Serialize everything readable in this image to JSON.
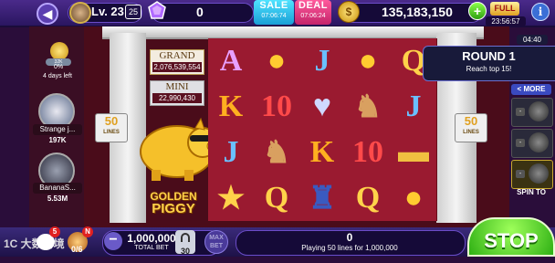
{
  "topbar": {
    "level_label": "Lv. 23",
    "level_badge": "25",
    "gems": "0",
    "sale": {
      "label": "SALE",
      "date": "07:06:74"
    },
    "deal": {
      "label": "DEAL",
      "date": "07:06:24"
    },
    "coins": "135,183,150",
    "plus": "+",
    "full_label": "FULL",
    "full_timer": "23:56:57",
    "info": "i",
    "back": "◀"
  },
  "piggy_bank": {
    "percent": "0%",
    "days_left": "4 days left",
    "amount": "32K"
  },
  "players": [
    {
      "name": "Strange j...",
      "coins": "197K"
    },
    {
      "name": "BananaS...",
      "coins": "5.53M"
    }
  ],
  "machine": {
    "lines_number": "50",
    "lines_label": "LINES",
    "grand_label": "GRAND",
    "grand_value": "2,076,539,554",
    "mini_label": "MINI",
    "mini_value": "22,990,430",
    "logo_line1": "GOLDEN",
    "logo_line2": "PIGGY"
  },
  "reels": [
    [
      {
        "s": "A",
        "c": "#e8a0ff"
      },
      {
        "s": "K",
        "c": "#ffb020"
      },
      {
        "s": "J",
        "c": "#6ac0ff"
      },
      {
        "s": "★",
        "c": "#ffd24a"
      }
    ],
    [
      {
        "s": "●",
        "c": "#ffcc30"
      },
      {
        "s": "10",
        "c": "#ff4a4a"
      },
      {
        "s": "♞",
        "c": "#d9a060"
      },
      {
        "s": "Q",
        "c": "#ffd24a"
      }
    ],
    [
      {
        "s": "J",
        "c": "#6ac0ff"
      },
      {
        "s": "♥",
        "c": "#cfd8ff"
      },
      {
        "s": "K",
        "c": "#ffb020"
      },
      {
        "s": "♜",
        "c": "#3a5ac0"
      }
    ],
    [
      {
        "s": "●",
        "c": "#ffcc30"
      },
      {
        "s": "♞",
        "c": "#d9a060"
      },
      {
        "s": "10",
        "c": "#ff4a4a"
      },
      {
        "s": "Q",
        "c": "#ffd24a"
      }
    ],
    [
      {
        "s": "Q",
        "c": "#ffd24a"
      },
      {
        "s": "J",
        "c": "#6ac0ff"
      },
      {
        "s": "▬",
        "c": "#f0c040"
      },
      {
        "s": "●",
        "c": "#ffcc30"
      }
    ]
  ],
  "round": {
    "title": "ROUND 1",
    "subtitle": "Reach top 15!",
    "timer": "04:40"
  },
  "leaderboard": {
    "more": "< MORE",
    "spin_to": "SPIN TO",
    "slots": [
      "-",
      "-",
      "-"
    ]
  },
  "bottombar": {
    "chat_badge": "5",
    "n_badge": "N",
    "mission_count": "0/6",
    "bet_minus": "−",
    "total_bet": "1,000,000",
    "total_bet_label": "TOTAL BET",
    "lock_number": "30",
    "max_bet_label1": "MAX",
    "max_bet_label2": "BET",
    "win_value": "0",
    "win_desc": "Playing 50 lines for 1,000,000",
    "stop": "STOP"
  },
  "watermark": "1C 大数跨境"
}
